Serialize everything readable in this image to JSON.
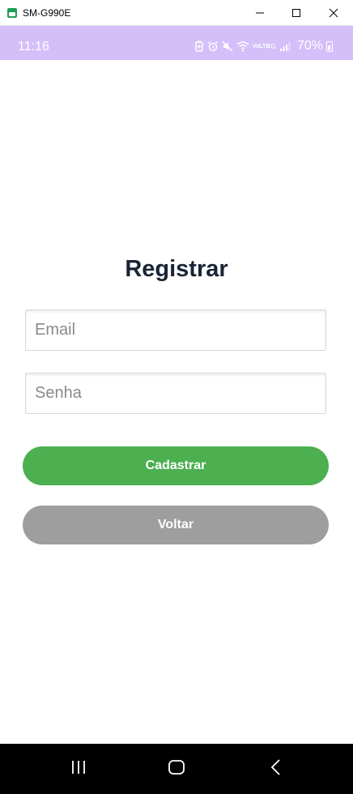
{
  "window": {
    "title": "SM-G990E"
  },
  "status_bar": {
    "time": "11:16",
    "battery_percent": "70%",
    "icons": [
      "battery-saver-icon",
      "alarm-icon",
      "mute-icon",
      "wifi-icon",
      "volte-icon",
      "4g-icon",
      "signal-icon"
    ],
    "volte_label": "VoLTE",
    "network_label": "4G",
    "background": "#d4bff9"
  },
  "register": {
    "title": "Registrar",
    "email_placeholder": "Email",
    "senha_placeholder": "Senha",
    "cadastrar_label": "Cadastrar",
    "voltar_label": "Voltar",
    "cadastrar_color": "#4caf50",
    "voltar_color": "#9e9e9e"
  },
  "nav_bar": {
    "icons": [
      "recents-icon",
      "home-icon",
      "back-icon"
    ]
  }
}
